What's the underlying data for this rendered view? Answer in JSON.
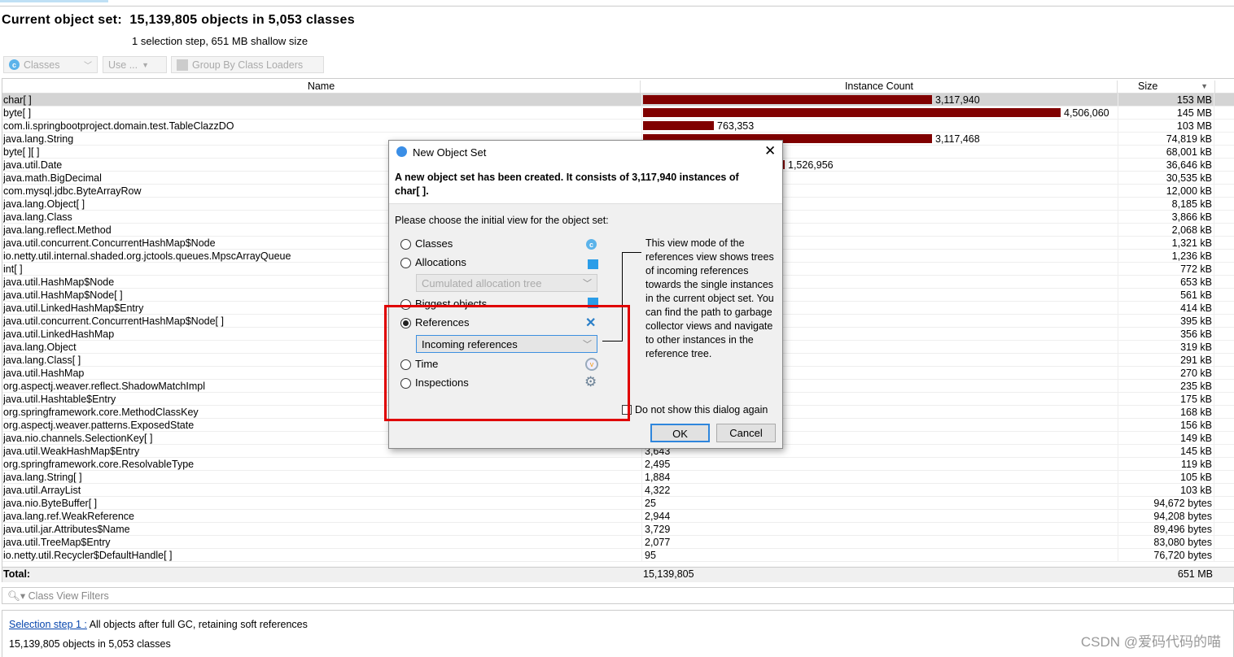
{
  "header": {
    "title": "Current object set:  15,139,805 objects in 5,053 classes",
    "subtitle": "1 selection step, 651 MB shallow size"
  },
  "toolbar": {
    "classes_label": "Classes",
    "use_label": "Use ...",
    "group_label": "Group By Class Loaders"
  },
  "table": {
    "columns": [
      "Name",
      "Instance Count",
      "Size"
    ],
    "max_count": 4506060,
    "rows": [
      {
        "name": "char[ ]",
        "count": "3,117,940",
        "count_value": 3117940,
        "size": "153 MB",
        "selected": true
      },
      {
        "name": "byte[ ]",
        "count": "4,506,060",
        "count_value": 4506060,
        "size": "145 MB"
      },
      {
        "name": "com.li.springbootproject.domain.test.TableClazzDO",
        "count": "763,353",
        "count_value": 763353,
        "size": "103 MB"
      },
      {
        "name": "java.lang.String",
        "count": "3,117,468",
        "count_value": 3117468,
        "size": "74,819 kB"
      },
      {
        "name": "byte[ ][ ]",
        "count": null,
        "size": "68,001 kB"
      },
      {
        "name": "java.util.Date",
        "count": "1,526,956",
        "count_value": 1526956,
        "size": "36,646 kB"
      },
      {
        "name": "java.math.BigDecimal",
        "count": null,
        "size": "30,535 kB"
      },
      {
        "name": "com.mysql.jdbc.ByteArrayRow",
        "count": null,
        "size": "12,000 kB"
      },
      {
        "name": "java.lang.Object[ ]",
        "count": null,
        "size": "8,185 kB"
      },
      {
        "name": "java.lang.Class",
        "count": null,
        "size": "3,866 kB"
      },
      {
        "name": "java.lang.reflect.Method",
        "count": null,
        "size": "2,068 kB"
      },
      {
        "name": "java.util.concurrent.ConcurrentHashMap$Node",
        "count": null,
        "size": "1,321 kB"
      },
      {
        "name": "io.netty.util.internal.shaded.org.jctools.queues.MpscArrayQueue",
        "count": null,
        "size": "1,236 kB"
      },
      {
        "name": "int[ ]",
        "count": null,
        "size": "772 kB"
      },
      {
        "name": "java.util.HashMap$Node",
        "count": null,
        "size": "653 kB"
      },
      {
        "name": "java.util.HashMap$Node[ ]",
        "count": null,
        "size": "561 kB"
      },
      {
        "name": "java.util.LinkedHashMap$Entry",
        "count": null,
        "size": "414 kB"
      },
      {
        "name": "java.util.concurrent.ConcurrentHashMap$Node[ ]",
        "count": null,
        "size": "395 kB"
      },
      {
        "name": "java.util.LinkedHashMap",
        "count": null,
        "size": "356 kB"
      },
      {
        "name": "java.lang.Object",
        "count": null,
        "size": "319 kB"
      },
      {
        "name": "java.lang.Class[ ]",
        "count": null,
        "size": "291 kB"
      },
      {
        "name": "java.util.HashMap",
        "count": null,
        "size": "270 kB"
      },
      {
        "name": "org.aspectj.weaver.reflect.ShadowMatchImpl",
        "count": null,
        "size": "235 kB"
      },
      {
        "name": "java.util.Hashtable$Entry",
        "count": null,
        "size": "175 kB"
      },
      {
        "name": "org.springframework.core.MethodClassKey",
        "count": null,
        "size": "168 kB"
      },
      {
        "name": "org.aspectj.weaver.patterns.ExposedState",
        "count": null,
        "size": "156 kB"
      },
      {
        "name": "java.nio.channels.SelectionKey[ ]",
        "count": null,
        "size": "149 kB"
      },
      {
        "name": "java.util.WeakHashMap$Entry",
        "count": "3,643",
        "count_value": 3643,
        "size": "145 kB"
      },
      {
        "name": "org.springframework.core.ResolvableType",
        "count": "2,495",
        "count_value": 2495,
        "size": "119 kB"
      },
      {
        "name": "java.lang.String[ ]",
        "count": "1,884",
        "count_value": 1884,
        "size": "105 kB"
      },
      {
        "name": "java.util.ArrayList",
        "count": "4,322",
        "count_value": 4322,
        "size": "103 kB"
      },
      {
        "name": "java.nio.ByteBuffer[ ]",
        "count": "25",
        "count_value": 25,
        "size": "94,672 bytes"
      },
      {
        "name": "java.lang.ref.WeakReference",
        "count": "2,944",
        "count_value": 2944,
        "size": "94,208 bytes"
      },
      {
        "name": "java.util.jar.Attributes$Name",
        "count": "3,729",
        "count_value": 3729,
        "size": "89,496 bytes"
      },
      {
        "name": "java.util.TreeMap$Entry",
        "count": "2,077",
        "count_value": 2077,
        "size": "83,080 bytes"
      },
      {
        "name": "io.netty.util.Recycler$DefaultHandle[ ]",
        "count": "95",
        "count_value": 95,
        "size": "76,720 bytes"
      }
    ],
    "total": {
      "label": "Total:",
      "count": "15,139,805",
      "size": "651 MB"
    }
  },
  "filter": {
    "placeholder": "Class View Filters"
  },
  "steps": {
    "link": "Selection step 1 :",
    "desc": " All objects after full GC, retaining soft references",
    "summary": "15,139,805 objects in 5,053 classes"
  },
  "dialog": {
    "title": "New Object Set",
    "message": "A new object set has been created. It consists of 3,117,940 instances of char[ ].",
    "prompt": "Please choose the initial view for the object set:",
    "options": {
      "classes": "Classes",
      "allocations": "Allocations",
      "allocation_combo": "Cumulated allocation tree",
      "biggest": "Biggest objects",
      "references": "References",
      "references_combo": "Incoming references",
      "time": "Time",
      "inspections": "Inspections"
    },
    "selected": "References",
    "description": "This view mode of the references view shows trees of incoming references towards the single instances in the current object set. You can find the path to garbage collector views and navigate to other instances in the reference tree.",
    "checkbox": "Do not show this dialog again",
    "ok": "OK",
    "cancel": "Cancel"
  },
  "colors": {
    "bar": "#800000",
    "highlight": "#e00000",
    "link": "#0645ad"
  },
  "watermark": "CSDN @爱码代码的喵"
}
